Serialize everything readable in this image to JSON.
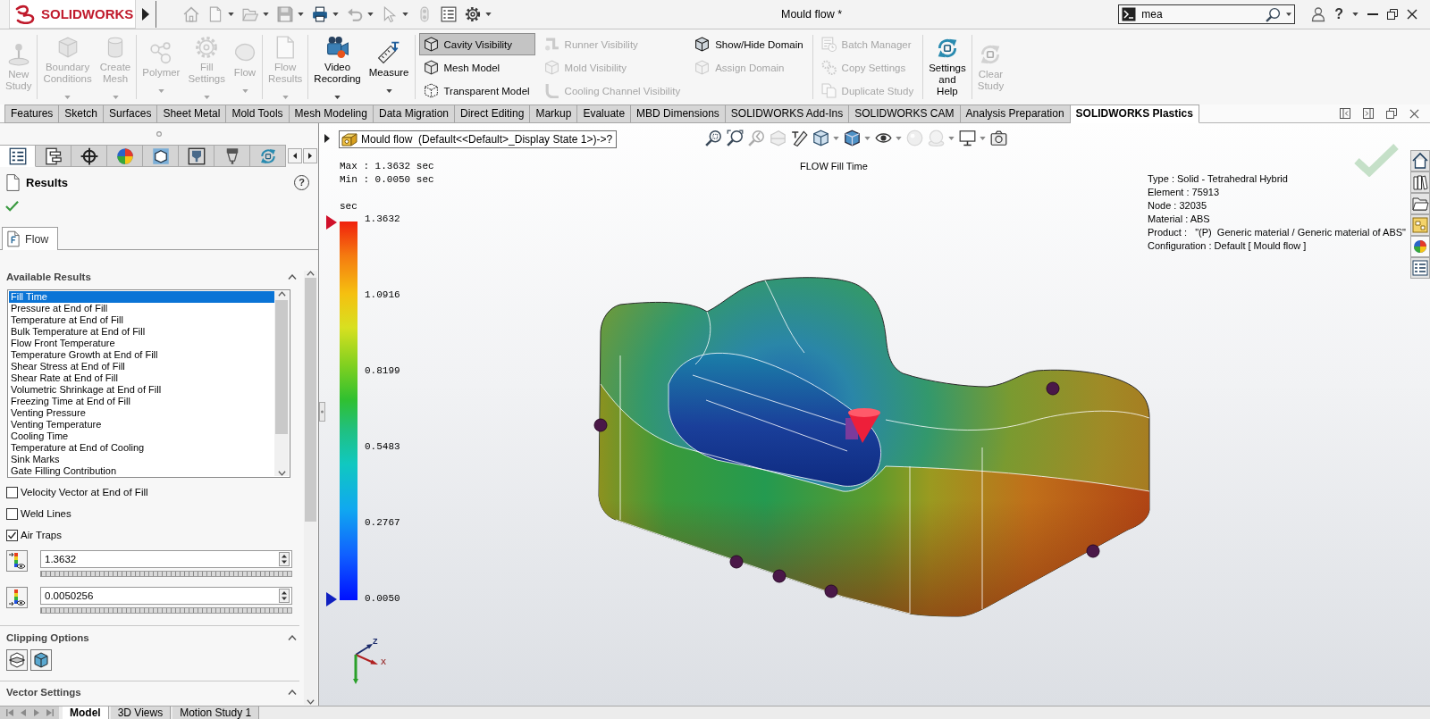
{
  "title_bar": {
    "logo": "SOLIDWORKS",
    "title": "Mould flow *",
    "search": {
      "value": "mea"
    },
    "help": "?"
  },
  "quick_access": [
    {
      "disabled": true,
      "dropdown": false
    },
    {
      "disabled": true,
      "dropdown": true
    },
    {
      "disabled": true,
      "dropdown": true
    },
    {
      "disabled": true,
      "dropdown": true
    },
    {
      "disabled": false,
      "dropdown": true
    },
    {
      "disabled": true,
      "dropdown": true
    },
    {
      "disabled": true,
      "dropdown": true
    },
    {
      "disabled": true,
      "dropdown": false
    },
    {
      "disabled": false,
      "dropdown": false
    },
    {
      "disabled": false,
      "dropdown": true
    }
  ],
  "ribbon": {
    "groups": [
      {
        "items": [
          {
            "kind": "large",
            "label": "New Study",
            "disabled": true,
            "dropdown": false
          }
        ]
      },
      {
        "items": [
          {
            "kind": "large",
            "label": "Boundary Conditions",
            "disabled": true,
            "dropdown": true
          },
          {
            "kind": "large",
            "label": "Create Mesh",
            "disabled": true,
            "dropdown": true
          }
        ]
      },
      {
        "items": [
          {
            "kind": "large",
            "label": "Polymer",
            "disabled": true,
            "dropdown": true
          },
          {
            "kind": "large",
            "label": "Fill Settings",
            "disabled": true,
            "dropdown": true
          },
          {
            "kind": "large",
            "label": "Flow",
            "disabled": true,
            "dropdown": true
          }
        ]
      },
      {
        "items": [
          {
            "kind": "large",
            "label": "Flow Results",
            "disabled": true,
            "dropdown": true
          }
        ]
      },
      {
        "items": [
          {
            "kind": "large",
            "label": "Video Recording",
            "disabled": false,
            "dropdown": true
          },
          {
            "kind": "large",
            "label": "Measure",
            "disabled": false,
            "dropdown": true
          }
        ]
      },
      {
        "items": [
          {
            "kind": "column",
            "items": [
              {
                "label": "Cavity Visibility",
                "disabled": false,
                "selected": true
              },
              {
                "label": "Mesh Model",
                "disabled": false,
                "selected": false
              },
              {
                "label": "Transparent Model",
                "disabled": false,
                "selected": false
              }
            ]
          },
          {
            "kind": "column",
            "items": [
              {
                "label": "Runner Visibility",
                "disabled": true,
                "selected": false
              },
              {
                "label": "Mold Visibility",
                "disabled": true,
                "selected": false
              },
              {
                "label": "Cooling Channel Visibility",
                "disabled": true,
                "selected": false
              }
            ]
          },
          {
            "kind": "column",
            "items": [
              {
                "label": "Show/Hide Domain",
                "disabled": false,
                "selected": false
              },
              {
                "label": "Assign Domain",
                "disabled": true,
                "selected": false
              }
            ]
          }
        ]
      },
      {
        "items": [
          {
            "kind": "column",
            "items": [
              {
                "label": "Batch Manager",
                "disabled": true,
                "selected": false
              },
              {
                "label": "Copy Settings",
                "disabled": true,
                "selected": false
              },
              {
                "label": "Duplicate Study",
                "disabled": true,
                "selected": false
              }
            ]
          }
        ]
      },
      {
        "items": [
          {
            "kind": "large",
            "label": "Settings and Help",
            "disabled": false,
            "dropdown": false
          }
        ]
      },
      {
        "items": [
          {
            "kind": "large",
            "label": "Clear Study",
            "disabled": true,
            "dropdown": false
          }
        ]
      }
    ]
  },
  "command_tabs": [
    {
      "label": "Features",
      "selected": false
    },
    {
      "label": "Sketch",
      "selected": false
    },
    {
      "label": "Surfaces",
      "selected": false
    },
    {
      "label": "Sheet Metal",
      "selected": false
    },
    {
      "label": "Mold Tools",
      "selected": false
    },
    {
      "label": "Mesh Modeling",
      "selected": false
    },
    {
      "label": "Data Migration",
      "selected": false
    },
    {
      "label": "Direct Editing",
      "selected": false
    },
    {
      "label": "Markup",
      "selected": false
    },
    {
      "label": "Evaluate",
      "selected": false
    },
    {
      "label": "MBD Dimensions",
      "selected": false
    },
    {
      "label": "SOLIDWORKS Add-Ins",
      "selected": false
    },
    {
      "label": "SOLIDWORKS CAM",
      "selected": false
    },
    {
      "label": "Analysis Preparation",
      "selected": false
    },
    {
      "label": "SOLIDWORKS Plastics",
      "selected": true
    }
  ],
  "property_manager": {
    "tabs": [
      {
        "selected": true
      },
      {
        "selected": false
      },
      {
        "selected": false
      },
      {
        "selected": false
      },
      {
        "selected": false
      },
      {
        "selected": false
      },
      {
        "selected": false
      },
      {
        "selected": false
      }
    ],
    "title": "Results",
    "help": "?",
    "feature_tab": {
      "label": "Flow",
      "selected": true
    },
    "available_results": {
      "title": "Available Results",
      "items": [
        {
          "label": "Fill Time",
          "selected": true
        },
        {
          "label": "Pressure at End of Fill",
          "selected": false
        },
        {
          "label": "Temperature at End of Fill",
          "selected": false
        },
        {
          "label": "Bulk Temperature at End of Fill",
          "selected": false
        },
        {
          "label": "Flow Front Temperature",
          "selected": false
        },
        {
          "label": "Temperature Growth at End of Fill",
          "selected": false
        },
        {
          "label": "Shear Stress at End of Fill",
          "selected": false
        },
        {
          "label": "Shear Rate at End of Fill",
          "selected": false
        },
        {
          "label": "Volumetric Shrinkage at End of Fill",
          "selected": false
        },
        {
          "label": "Freezing Time at End of Fill",
          "selected": false
        },
        {
          "label": "Venting Pressure",
          "selected": false
        },
        {
          "label": "Venting Temperature",
          "selected": false
        },
        {
          "label": "Cooling Time",
          "selected": false
        },
        {
          "label": "Temperature at End of Cooling",
          "selected": false
        },
        {
          "label": "Sink Marks",
          "selected": false
        },
        {
          "label": "Gate Filling Contribution",
          "selected": false
        }
      ]
    },
    "options": [
      {
        "label": "Velocity Vector at End of Fill",
        "checked": false
      },
      {
        "label": "Weld Lines",
        "checked": false
      },
      {
        "label": "Air Traps",
        "checked": true
      }
    ],
    "range": [
      {
        "value": "1.3632"
      },
      {
        "value": "0.0050256"
      }
    ],
    "sections": [
      {
        "kind": "clipping",
        "title": "Clipping Options"
      },
      {
        "kind": "plain",
        "title": "Vector Settings"
      }
    ]
  },
  "viewport": {
    "tree_label": "Mould flow  (Default<<Default>_Display State 1>)->?",
    "heads_up": [
      {
        "disabled": false,
        "dropdown": false
      },
      {
        "disabled": false,
        "dropdown": false
      },
      {
        "disabled": true,
        "dropdown": false
      },
      {
        "disabled": true,
        "dropdown": false
      },
      {
        "disabled": false,
        "dropdown": false
      },
      {
        "disabled": false,
        "dropdown": true
      },
      {
        "disabled": false,
        "dropdown": true
      },
      {
        "disabled": false,
        "dropdown": true
      },
      {
        "disabled": true,
        "dropdown": false
      },
      {
        "disabled": true,
        "dropdown": true
      },
      {
        "disabled": false,
        "dropdown": true
      },
      {
        "disabled": false,
        "dropdown": false
      }
    ],
    "max": "Max : 1.3632 sec",
    "min": "Min : 0.0050 sec",
    "plot_title": "FLOW Fill Time",
    "legend": {
      "unit": "sec",
      "ticks": [
        "1.3632",
        "1.0916",
        "0.8199",
        "0.5483",
        "0.2767",
        "0.0050"
      ]
    },
    "info": [
      "Type : Solid - Tetrahedral Hybrid",
      "Element : 75913",
      "Node : 32035",
      "Material : ABS",
      "Product :   \"(P)  Generic material / Generic material of ABS\"",
      "Configuration : Default [ Mould flow ]"
    ],
    "axis_labels": [
      "Z",
      "X"
    ]
  },
  "bottom_tabs": [
    {
      "label": "Model",
      "selected": true
    },
    {
      "label": "3D Views",
      "selected": false
    },
    {
      "label": "Motion Study 1",
      "selected": false
    }
  ]
}
